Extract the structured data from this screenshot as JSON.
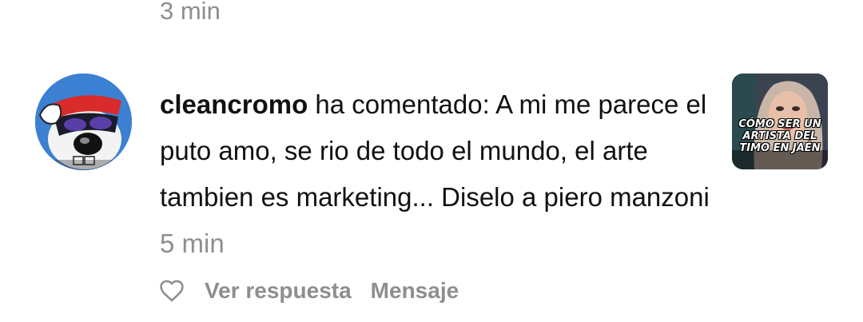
{
  "previous": {
    "time": "3 min"
  },
  "notification": {
    "username": "cleancromo",
    "action": "ha comentado:",
    "text": "A mi me parece el puto amo, se rio de todo el mundo, el arte tambien es marketing... Diselo a piero manzoni",
    "time": "5 min"
  },
  "thumbnail": {
    "caption_line1": "CÓMO SER UN",
    "caption_line2": "ARTISTA DEL",
    "caption_line3": "TIMO EN JAÉN"
  },
  "actions": {
    "like_icon": "heart-outline-icon",
    "reply_label": "Ver respuesta",
    "message_label": "Mensaje"
  },
  "colors": {
    "text": "#111111",
    "muted": "#8e8e8e",
    "background": "#ffffff"
  }
}
